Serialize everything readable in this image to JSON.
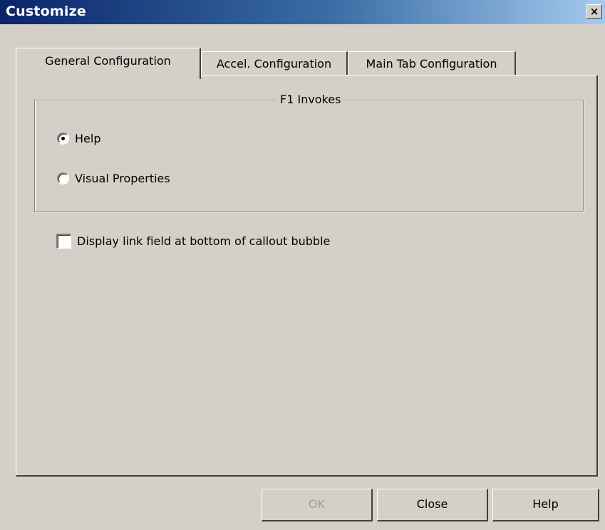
{
  "window": {
    "title": "Customize",
    "close_label": "×"
  },
  "tabs": [
    {
      "label": "General Configuration",
      "selected": true
    },
    {
      "label": "Accel. Configuration",
      "selected": false
    },
    {
      "label": "Main Tab Configuration",
      "selected": false
    }
  ],
  "f1_group": {
    "legend": "F1 Invokes",
    "options": [
      {
        "label": "Help",
        "checked": true
      },
      {
        "label": "Visual Properties",
        "checked": false
      }
    ]
  },
  "checkbox": {
    "label": "Display link field at bottom of callout bubble",
    "checked": false
  },
  "buttons": {
    "ok": "OK",
    "close": "Close",
    "help": "Help"
  }
}
